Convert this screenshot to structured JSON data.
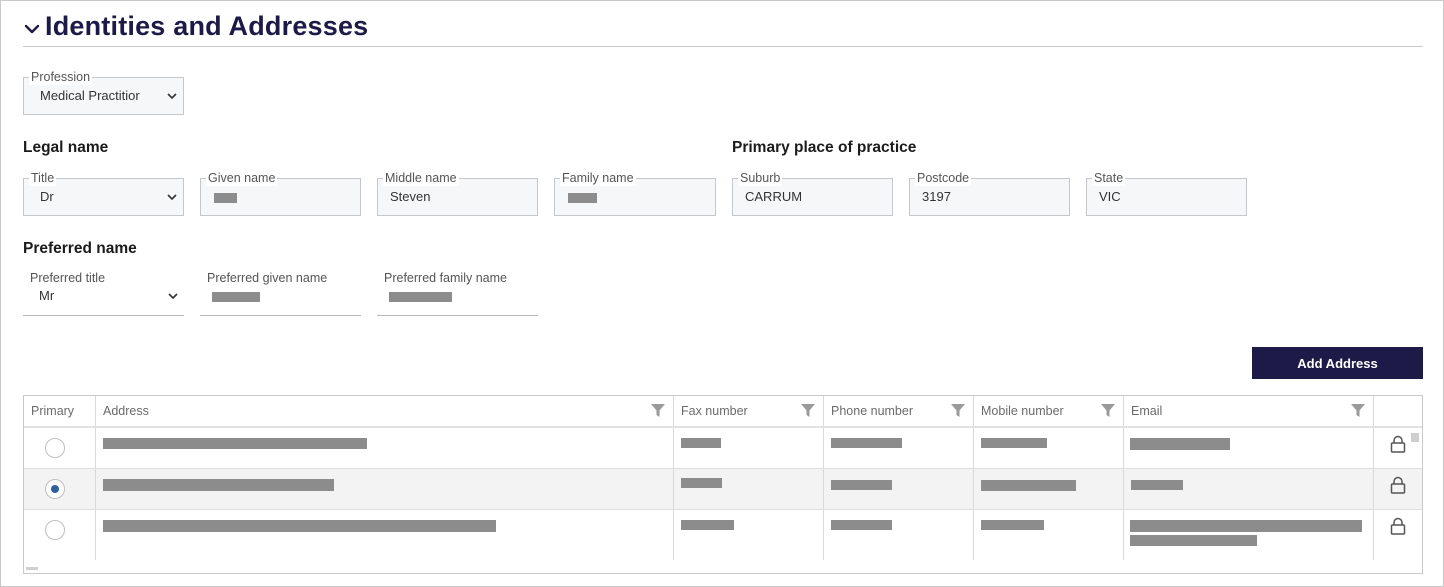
{
  "section": {
    "title": "Identities and Addresses",
    "toggle_icon": "chevron-down-icon"
  },
  "profession": {
    "label": "Profession",
    "value": "Medical Practitior"
  },
  "legal_name": {
    "heading": "Legal name",
    "title_label": "Title",
    "title_value": "Dr",
    "given_label": "Given name",
    "middle_label": "Middle name",
    "middle_value": "Steven",
    "family_label": "Family name"
  },
  "practice": {
    "heading": "Primary place of practice",
    "suburb_label": "Suburb",
    "suburb_value": "CARRUM",
    "postcode_label": "Postcode",
    "postcode_value": "3197",
    "state_label": "State",
    "state_value": "VIC"
  },
  "preferred_name": {
    "heading": "Preferred name",
    "title_label": "Preferred title",
    "title_value": "Mr",
    "given_label": "Preferred given name",
    "family_label": "Preferred family name"
  },
  "add_address_label": "Add Address",
  "table": {
    "columns": [
      "Primary",
      "Address",
      "Fax number",
      "Phone number",
      "Mobile number",
      "Email"
    ],
    "rows": [
      {
        "primary": false,
        "locked": true
      },
      {
        "primary": true,
        "locked": true
      },
      {
        "primary": false,
        "locked": true
      }
    ]
  },
  "colors": {
    "accent": "#1e1a47",
    "radio_selected": "#2f5f9e"
  }
}
